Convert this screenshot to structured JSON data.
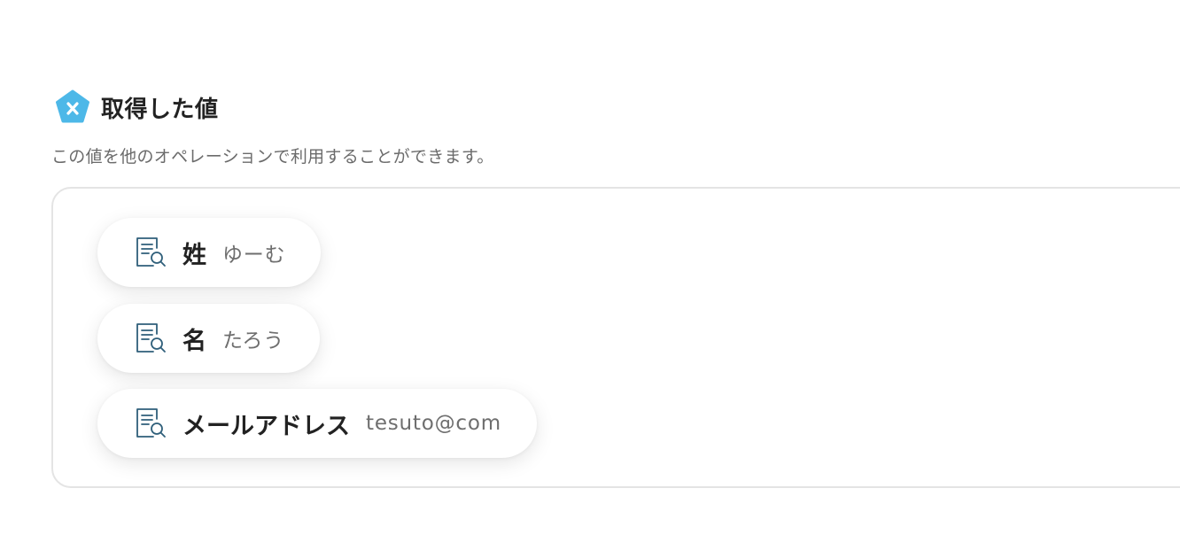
{
  "header": {
    "title": "取得した値",
    "logo_icon": "pentagon-x-logo-icon",
    "logo_color": "#4db8e8"
  },
  "subtitle": "この値を他のオペレーションで利用することができます。",
  "fields": [
    {
      "label": "姓",
      "value": "ゆーむ",
      "icon": "document-search-icon"
    },
    {
      "label": "名",
      "value": "たろう",
      "icon": "document-search-icon"
    },
    {
      "label": "メールアドレス",
      "value": "tesuto@com",
      "icon": "document-search-icon"
    }
  ],
  "colors": {
    "icon_stroke": "#2f5f7a",
    "border": "#e4e4e4"
  }
}
